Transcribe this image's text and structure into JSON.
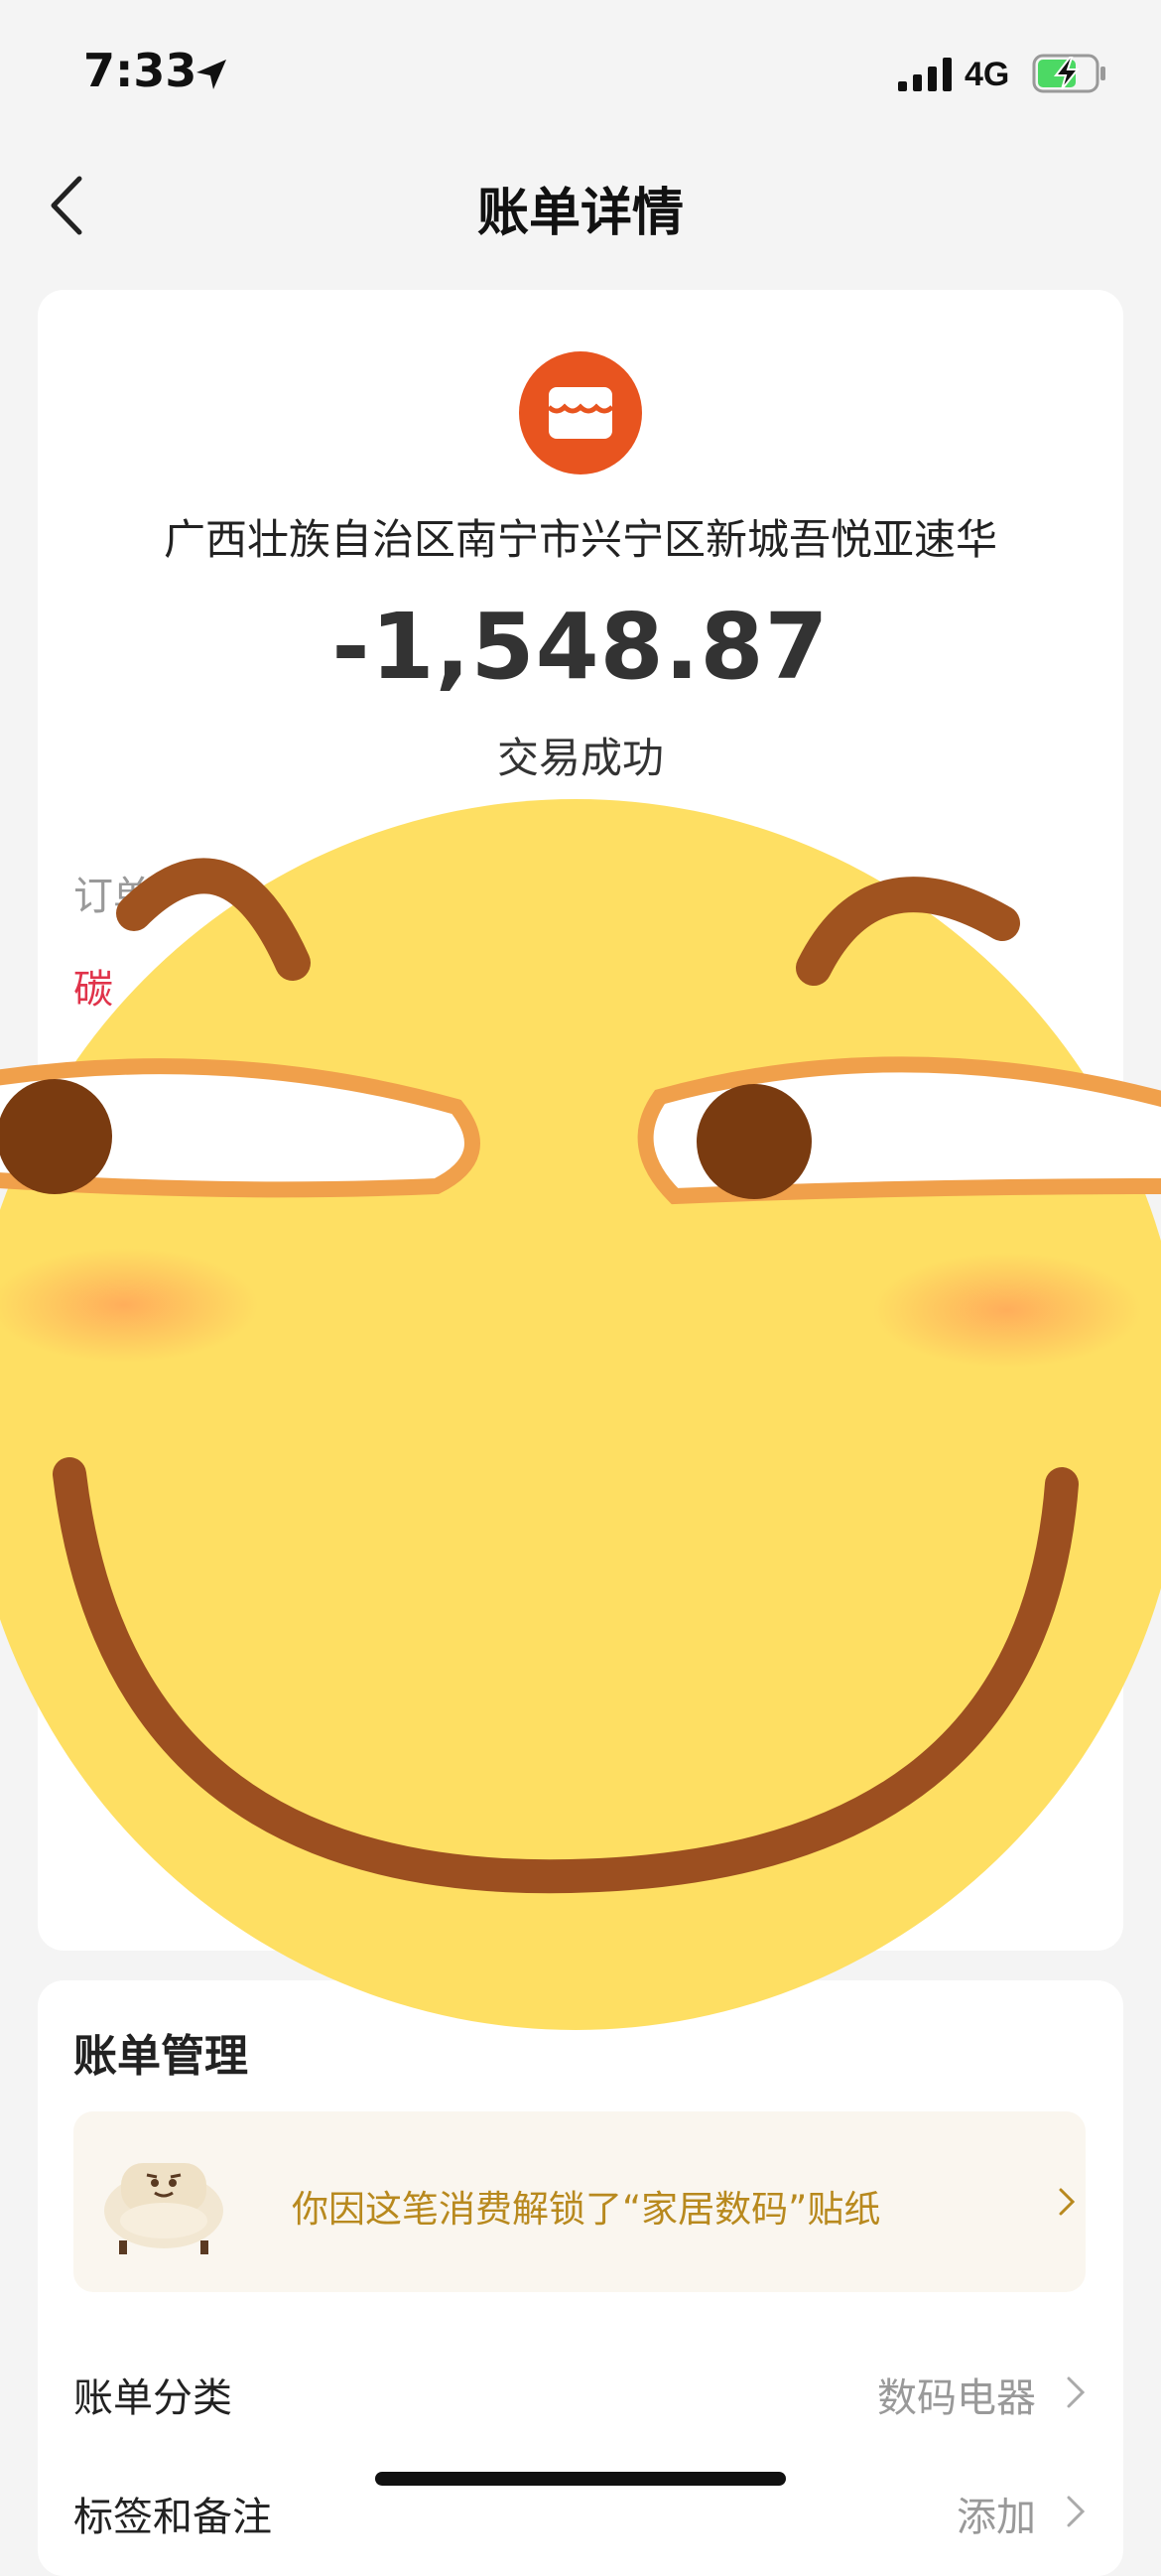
{
  "status_bar": {
    "time": "7:33",
    "network": "4G"
  },
  "nav": {
    "title": "账单详情"
  },
  "transaction": {
    "merchant": "广西壮族自治区南宁市兴宁区新城吾悦亚速华",
    "amount": "-1,548.87",
    "status": "交易成功",
    "order_label_partial": "订单",
    "red_text_partial": "碳"
  },
  "bill_management": {
    "title": "账单管理",
    "sticker_text": "你因这笔消费解锁了“家居数码”贴纸",
    "rows": [
      {
        "label": "账单分类",
        "value": "数码电器"
      },
      {
        "label": "标签和备注",
        "value": "添加"
      }
    ]
  },
  "colors": {
    "brand_orange": "#e8541f",
    "sticker_gold": "#b8891e",
    "emoji_yellow": "#fedf63"
  }
}
